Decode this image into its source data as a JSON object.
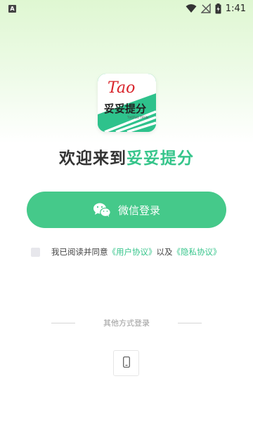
{
  "status_bar": {
    "notification_icon": "A",
    "time": "1:41",
    "icons": [
      "wifi-icon",
      "no-signal-icon",
      "battery-icon"
    ],
    "battery_glyph": "⚡"
  },
  "logo": {
    "script_text": "Tao",
    "main_text": "妥妥提分",
    "sub_text": "TUOTUO TIFEN",
    "colors": {
      "background": "#2ec28c",
      "text_red": "#d8232a"
    }
  },
  "welcome": {
    "prefix": "欢迎来到",
    "brand": "妥妥提分"
  },
  "wechat_login": {
    "label": "微信登录",
    "icon": "wechat-icon",
    "color": "#45c98a"
  },
  "agreement": {
    "checked": false,
    "text_prefix": "我已阅读并同意",
    "user_agreement": "《用户协议》",
    "joiner": "以及",
    "privacy_policy": "《隐私协议》"
  },
  "other_login": {
    "label": "其他方式登录",
    "options": [
      "phone-icon"
    ]
  },
  "colors": {
    "accent": "#36c58b"
  }
}
